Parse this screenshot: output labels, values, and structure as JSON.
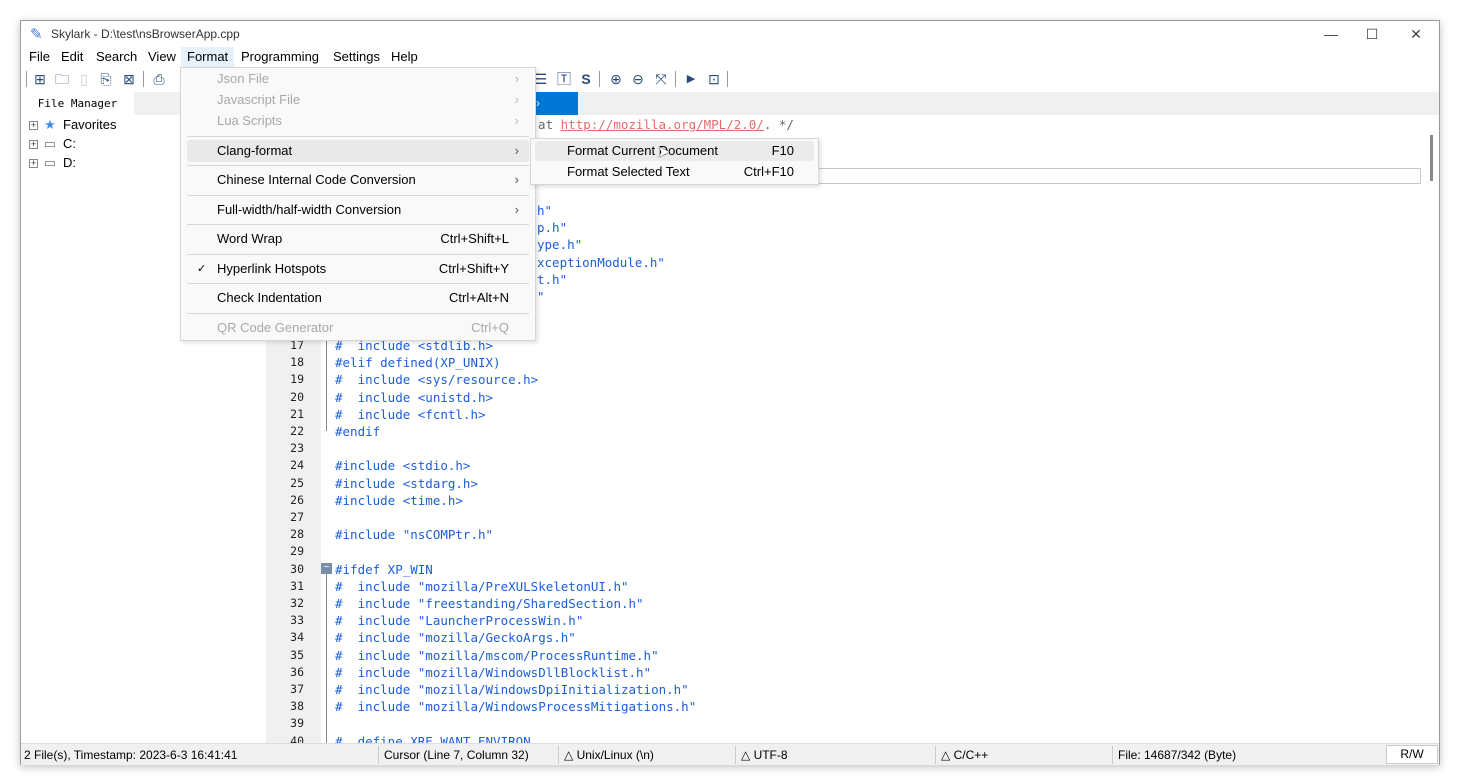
{
  "window": {
    "title": "Skylark - D:\\test\\nsBrowserApp.cpp",
    "controls": [
      "minimize",
      "maximize",
      "close"
    ]
  },
  "menubar": [
    "File",
    "Edit",
    "Search",
    "View",
    "Format",
    "Programming",
    "Settings",
    "Help"
  ],
  "toolbar": {
    "icons": [
      "new-file-icon",
      "open-folder-icon",
      "save-icon",
      "save-all-icon",
      "close-file-icon",
      "print-icon",
      "indent-icon",
      "text-icon",
      "s-icon",
      "zoom-in-icon",
      "zoom-out-icon",
      "fullscreen-icon",
      "run-icon",
      "terminal-icon"
    ]
  },
  "tabs": {
    "file_manager": "File Manager",
    "active_file": "›"
  },
  "tree": [
    {
      "label": "Favorites",
      "icon": "star-icon"
    },
    {
      "label": "C:",
      "icon": "drive-icon"
    },
    {
      "label": "D:",
      "icon": "drive-icon"
    }
  ],
  "format_menu": {
    "items": [
      {
        "label": "Json File",
        "disabled": true,
        "submenu": true
      },
      {
        "label": "Javascript File",
        "disabled": true,
        "submenu": true
      },
      {
        "label": "Lua Scripts",
        "disabled": true,
        "submenu": true
      },
      {
        "label": "Clang-format",
        "submenu": true,
        "highlighted": true
      },
      {
        "label": "Chinese Internal Code Conversion",
        "submenu": true
      },
      {
        "label": "Full-width/half-width Conversion",
        "submenu": true
      },
      {
        "label": "Word Wrap",
        "shortcut": "Ctrl+Shift+L"
      },
      {
        "label": "Hyperlink Hotspots",
        "shortcut": "Ctrl+Shift+Y",
        "checked": true
      },
      {
        "label": "Check Indentation",
        "shortcut": "Ctrl+Alt+N"
      },
      {
        "label": "QR Code Generator",
        "shortcut": "Ctrl+Q",
        "disabled": true
      }
    ]
  },
  "clang_submenu": [
    {
      "label": "Format Current Document",
      "shortcut": "F10"
    },
    {
      "label": "Format Selected Text",
      "shortcut": "Ctrl+F10"
    }
  ],
  "code": {
    "line4_pre": "e at ",
    "line4_link": "http://mozilla.org/MPL/2.0/",
    "line4_post": ". */",
    "fragments": [
      "h\"",
      "p.h\"",
      "ype.h\"",
      "xceptionModule.h\"",
      "t.h\"",
      "\""
    ],
    "lines": [
      {
        "n": "17",
        "t": "#  include <stdlib.h>"
      },
      {
        "n": "18",
        "t": "#elif defined(XP_UNIX)"
      },
      {
        "n": "19",
        "t": "#  include <sys/resource.h>"
      },
      {
        "n": "20",
        "t": "#  include <unistd.h>"
      },
      {
        "n": "21",
        "t": "#  include <fcntl.h>"
      },
      {
        "n": "22",
        "t": "#endif"
      },
      {
        "n": "23",
        "t": ""
      },
      {
        "n": "24",
        "t": "#include <stdio.h>"
      },
      {
        "n": "25",
        "t": "#include <stdarg.h>"
      },
      {
        "n": "26",
        "t": "#include <time.h>"
      },
      {
        "n": "27",
        "t": ""
      },
      {
        "n": "28",
        "t": "#include \"nsCOMPtr.h\""
      },
      {
        "n": "29",
        "t": ""
      },
      {
        "n": "30",
        "t": "#ifdef XP_WIN"
      },
      {
        "n": "31",
        "t": "#  include \"mozilla/PreXULSkeletonUI.h\""
      },
      {
        "n": "32",
        "t": "#  include \"freestanding/SharedSection.h\""
      },
      {
        "n": "33",
        "t": "#  include \"LauncherProcessWin.h\""
      },
      {
        "n": "34",
        "t": "#  include \"mozilla/GeckoArgs.h\""
      },
      {
        "n": "35",
        "t": "#  include \"mozilla/mscom/ProcessRuntime.h\""
      },
      {
        "n": "36",
        "t": "#  include \"mozilla/WindowsDllBlocklist.h\""
      },
      {
        "n": "37",
        "t": "#  include \"mozilla/WindowsDpiInitialization.h\""
      },
      {
        "n": "38",
        "t": "#  include \"mozilla/WindowsProcessMitigations.h\""
      },
      {
        "n": "39",
        "t": ""
      },
      {
        "n": "40",
        "t": "#  define XRE_WANT_ENVIRON"
      }
    ]
  },
  "status": {
    "files": "2 File(s), Timestamp: 2023-6-3 16:41:41",
    "cursor": "Cursor (Line 7, Column 32)",
    "eol": "Unix/Linux (\\n)",
    "encoding": "UTF-8",
    "language": "C/C++",
    "filesize": "File: 14687/342 (Byte)",
    "mode": "R/W"
  }
}
